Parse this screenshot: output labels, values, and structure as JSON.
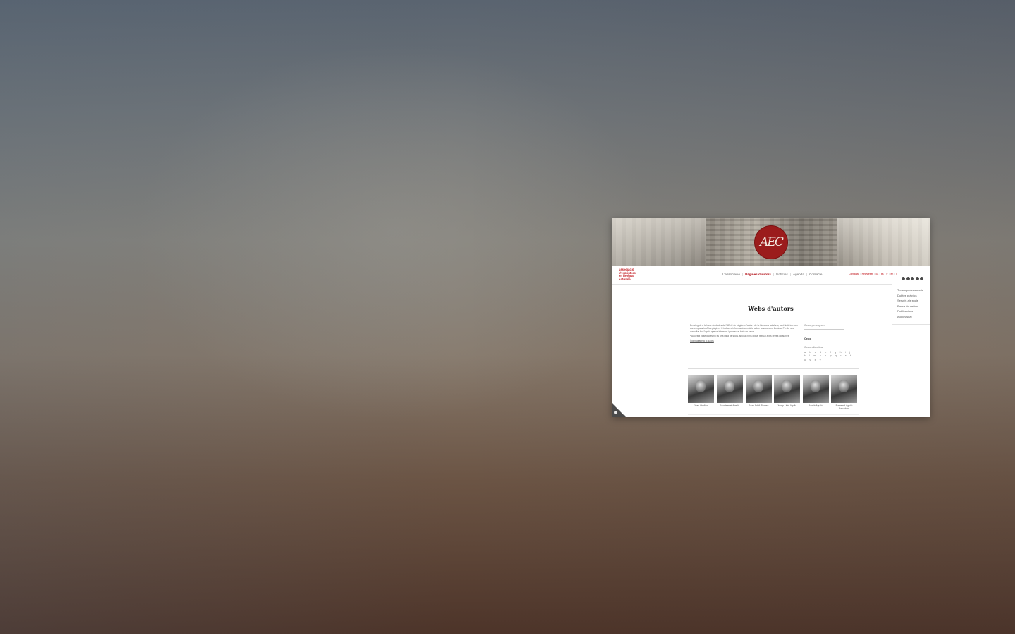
{
  "site": {
    "brand_lines": [
      "associació",
      "d'escriptors",
      "en llengua",
      "catalana"
    ],
    "logo_text": "AEC"
  },
  "nav": {
    "items": [
      {
        "label": "L'associació",
        "active": false
      },
      {
        "label": "Pàgines d'autors",
        "active": true
      },
      {
        "label": "Notícies",
        "active": false
      },
      {
        "label": "Agenda",
        "active": false
      },
      {
        "label": "Contacte",
        "active": false
      }
    ],
    "top_links": [
      "Contactar",
      "Newsletter",
      "ca",
      "es",
      "fr",
      "en",
      "it"
    ],
    "social_icons": [
      "twitter-icon",
      "instagram-icon",
      "facebook-icon",
      "linkedin-icon",
      "youtube-icon"
    ]
  },
  "side_menu": {
    "items": [
      "Temes professionals",
      "Dubtes pràctics",
      "Serveis als socis",
      "Bases de dades",
      "Publicacions",
      "Audiovisual"
    ]
  },
  "page": {
    "title": "Webs d'autors",
    "intro_paragraphs": [
      "Benvinguts a la base de dades de l'AELC de pàgines d'autors de la literatura catalana, tant històrics com contemporanis. A les pàgines hi trobareu informació completa sobre la seva obra literària. Per fer una consulta, feu l'opció que us interessi i premeu el botó de cerca.",
      "* Aquesta base dades no és una llista de socis, sinó un fons digital textual a les lletres catalanes."
    ],
    "intro_link": "Índex alfabètic d'autors",
    "search_label": "Cerca per cognom",
    "search_button": "Cerca",
    "alpha_label": "Cerca alfabètica",
    "alphabet_text": "a b c d e f g h i j k l m n o p q r s t u v x y"
  },
  "authors": [
    {
      "name_lines": [
        "Joan Abellan"
      ]
    },
    {
      "name_lines": [
        "Montserrat Abelló"
      ]
    },
    {
      "name_lines": [
        "Joan Adell Álvarez"
      ]
    },
    {
      "name_lines": [
        "Josep Lluís Aguiló"
      ]
    },
    {
      "name_lines": [
        "Marià Aguiló"
      ]
    },
    {
      "name_lines": [
        "Raimund Aguiló",
        "Barceloné"
      ]
    }
  ]
}
